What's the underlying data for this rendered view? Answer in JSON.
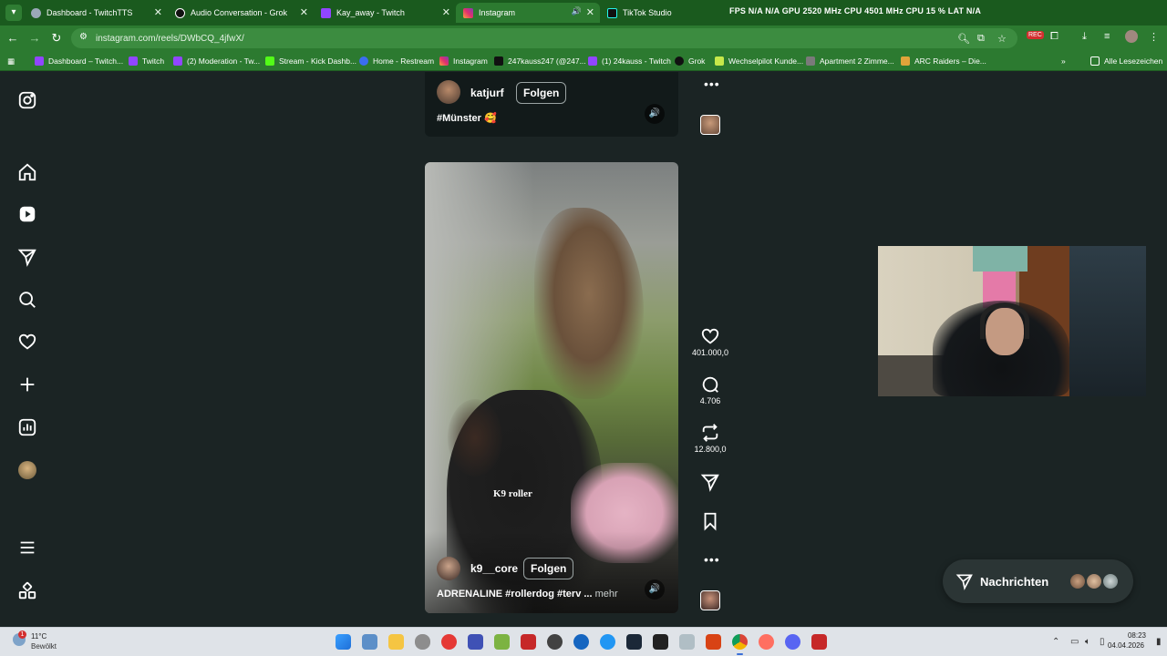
{
  "browser": {
    "tabs": [
      {
        "label": "Dashboard - TwitchTTS",
        "favicon": "globe-icon",
        "color": "#9aa8b8"
      },
      {
        "label": "Audio Conversation - Grok",
        "favicon": "grok-icon",
        "color": "#111111"
      },
      {
        "label": "Kay_away - Twitch",
        "favicon": "twitch-icon",
        "color": "#9146ff"
      },
      {
        "label": "Instagram",
        "favicon": "instagram-icon",
        "color": "#e1306c",
        "active": true
      },
      {
        "label": "TikTok Studio",
        "favicon": "tiktok-icon",
        "color": "#111111"
      }
    ],
    "osd_overlay": "FPS N/A N/A GPU 2520 MHz CPU 4501 MHz CPU 15 % LAT N/A",
    "url": "instagram.com/reels/DWbCQ_4jfwX/",
    "bookmarks": [
      {
        "label": "Dashboard – Twitch...",
        "color": "#9146ff"
      },
      {
        "label": "Twitch",
        "color": "#9146ff"
      },
      {
        "label": "(2) Moderation - Tw...",
        "color": "#9146ff"
      },
      {
        "label": "Stream - Kick Dashb...",
        "color": "#53fc18"
      },
      {
        "label": "Home - Restream",
        "color": "#3b6df0"
      },
      {
        "label": "Instagram",
        "color": "#e1306c"
      },
      {
        "label": "247kauss247 (@247...",
        "color": "#111111"
      },
      {
        "label": "(1) 24kauss - Twitch",
        "color": "#9146ff"
      },
      {
        "label": "Grok",
        "color": "#111111"
      },
      {
        "label": "Wechselpilot Kunde...",
        "color": "#c7e84a"
      },
      {
        "label": "Apartment 2 Zimme...",
        "color": "#7a7a7a"
      },
      {
        "label": "ARC Raiders – Die...",
        "color": "#e0a43a"
      }
    ],
    "all_bookmarks_label": "Alle Lesezeichen"
  },
  "instagram": {
    "top_reel": {
      "username": "katjurf",
      "follow_label": "Folgen",
      "caption": "#Münster 🥰"
    },
    "main_reel": {
      "username": "k9__core",
      "follow_label": "Folgen",
      "overlay_text": "K9 roller",
      "caption": "ADRENALINE #rollerdog #terv ...",
      "more_label": "mehr"
    },
    "actions": {
      "likes": "401.000,0",
      "comments": "4.706",
      "reposts": "12.800,0"
    },
    "messages_label": "Nachrichten"
  },
  "taskbar": {
    "weather_temp": "11°C",
    "weather_desc": "Bewölkt",
    "weather_badge": "1",
    "time": "08:23",
    "date": "04.04.2026"
  }
}
